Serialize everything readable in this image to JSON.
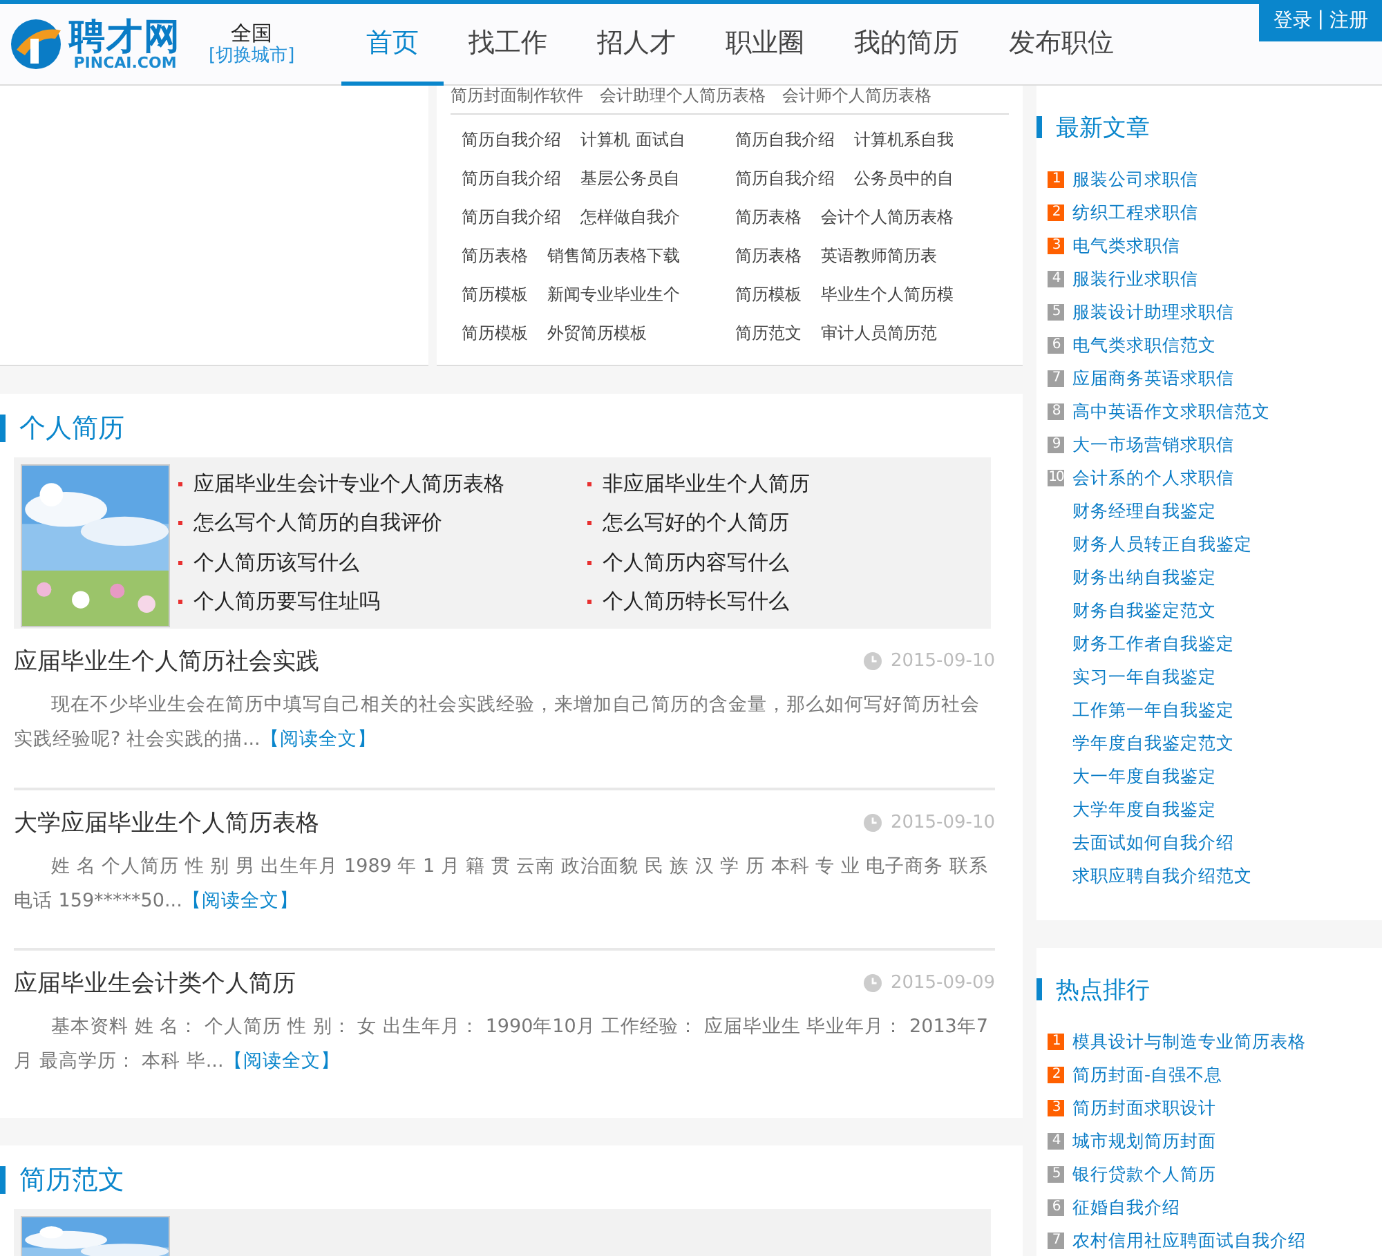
{
  "header": {
    "logo": {
      "name": "聘才网",
      "domain": "PINCAI.COM"
    },
    "city": {
      "name": "全国",
      "switch": "[切换城市]"
    },
    "nav": [
      {
        "label": "首页",
        "selected": true
      },
      {
        "label": "找工作",
        "selected": false
      },
      {
        "label": "招人才",
        "selected": false
      },
      {
        "label": "职业圈",
        "selected": false
      },
      {
        "label": "我的简历",
        "selected": false
      },
      {
        "label": "发布职位",
        "selected": false
      }
    ],
    "auth": {
      "login": "登录",
      "separator": "|",
      "register": "注册"
    }
  },
  "keywords": {
    "top_links": [
      "简历封面制作软件",
      "会计助理个人简历表格",
      "会计师个人简历表格"
    ],
    "rows": [
      [
        {
          "category": "简历自我介绍",
          "title": "计算机 面试自"
        },
        {
          "category": "简历自我介绍",
          "title": "计算机系自我"
        }
      ],
      [
        {
          "category": "简历自我介绍",
          "title": "基层公务员自"
        },
        {
          "category": "简历自我介绍",
          "title": "公务员中的自"
        }
      ],
      [
        {
          "category": "简历自我介绍",
          "title": "怎样做自我介"
        },
        {
          "category": "简历表格",
          "title": "会计个人简历表格"
        }
      ],
      [
        {
          "category": "简历表格",
          "title": "销售简历表格下载"
        },
        {
          "category": "简历表格",
          "title": "英语教师简历表"
        }
      ],
      [
        {
          "category": "简历模板",
          "title": "新闻专业毕业生个"
        },
        {
          "category": "简历模板",
          "title": "毕业生个人简历模"
        }
      ],
      [
        {
          "category": "简历模板",
          "title": "外贸简历模板"
        },
        {
          "category": "简历范文",
          "title": "审计人员简历范"
        }
      ]
    ]
  },
  "sections": [
    {
      "title": "个人简历",
      "featured": {
        "links": [
          "应届毕业生会计专业个人简历表格",
          "非应届毕业生个人简历",
          "怎么写个人简历的自我评价",
          "怎么写好的个人简历",
          "个人简历该写什么",
          "个人简历内容写什么",
          "个人简历要写住址吗",
          "个人简历特长写什么"
        ]
      },
      "articles": [
        {
          "title": "应届毕业生个人简历社会实践",
          "date": "2015-09-10",
          "summary": "现在不少毕业生会在简历中填写自己相关的社会实践经验，来增加自己简历的含金量，那么如何写好简历社会实践经验呢? 社会实践的描...",
          "read_more": "【阅读全文】"
        },
        {
          "title": "大学应届毕业生个人简历表格",
          "date": "2015-09-10",
          "summary": "姓 名 个人简历 性 别 男 出生年月 1989 年 1 月 籍 贯 云南 政治面貌 民 族 汉 学 历 本科 专 业 电子商务 联系电话 159*****50...",
          "read_more": "【阅读全文】"
        },
        {
          "title": "应届毕业生会计类个人简历",
          "date": "2015-09-09",
          "summary": "基本资料 姓 名： 个人简历 性 别： 女 出生年月： 1990年10月 工作经验： 应届毕业生 毕业年月： 2013年7月 最高学历： 本科 毕...",
          "read_more": "【阅读全文】"
        }
      ]
    },
    {
      "title": "简历范文"
    }
  ],
  "sidebar": [
    {
      "title": "最新文章",
      "items": [
        {
          "rank": "1",
          "title": "服装公司求职信",
          "color": "#ff6000"
        },
        {
          "rank": "2",
          "title": "纺织工程求职信",
          "color": "#ff6000"
        },
        {
          "rank": "3",
          "title": "电气类求职信",
          "color": "#ff6000"
        },
        {
          "rank": "4",
          "title": "服装行业求职信",
          "color": "#a0a0a0"
        },
        {
          "rank": "5",
          "title": "服装设计助理求职信",
          "color": "#a0a0a0"
        },
        {
          "rank": "6",
          "title": "电气类求职信范文",
          "color": "#a0a0a0"
        },
        {
          "rank": "7",
          "title": "应届商务英语求职信",
          "color": "#a0a0a0"
        },
        {
          "rank": "8",
          "title": "高中英语作文求职信范文",
          "color": "#a0a0a0"
        },
        {
          "rank": "9",
          "title": "大一市场营销求职信",
          "color": "#a0a0a0"
        },
        {
          "rank": "10",
          "title": "会计系的个人求职信",
          "color": "#a0a0a0"
        },
        {
          "title": "财务经理自我鉴定"
        },
        {
          "title": "财务人员转正自我鉴定"
        },
        {
          "title": "财务出纳自我鉴定"
        },
        {
          "title": "财务自我鉴定范文"
        },
        {
          "title": "财务工作者自我鉴定"
        },
        {
          "title": "实习一年自我鉴定"
        },
        {
          "title": "工作第一年自我鉴定"
        },
        {
          "title": "学年度自我鉴定范文"
        },
        {
          "title": "大一年度自我鉴定"
        },
        {
          "title": "大学年度自我鉴定"
        },
        {
          "title": "去面试如何自我介绍"
        },
        {
          "title": "求职应聘自我介绍范文"
        }
      ]
    },
    {
      "title": "热点排行",
      "items": [
        {
          "rank": "1",
          "title": "模具设计与制造专业简历表格",
          "color": "#ff6000"
        },
        {
          "rank": "2",
          "title": "简历封面-自强不息",
          "color": "#ff6000"
        },
        {
          "rank": "3",
          "title": "简历封面求职设计",
          "color": "#ff6000"
        },
        {
          "rank": "4",
          "title": "城市规划简历封面",
          "color": "#a0a0a0"
        },
        {
          "rank": "5",
          "title": "银行贷款个人简历",
          "color": "#a0a0a0"
        },
        {
          "rank": "6",
          "title": "征婚自我介绍",
          "color": "#a0a0a0"
        },
        {
          "rank": "7",
          "title": "农村信用社应聘面试自我介绍",
          "color": "#a0a0a0"
        }
      ]
    }
  ]
}
